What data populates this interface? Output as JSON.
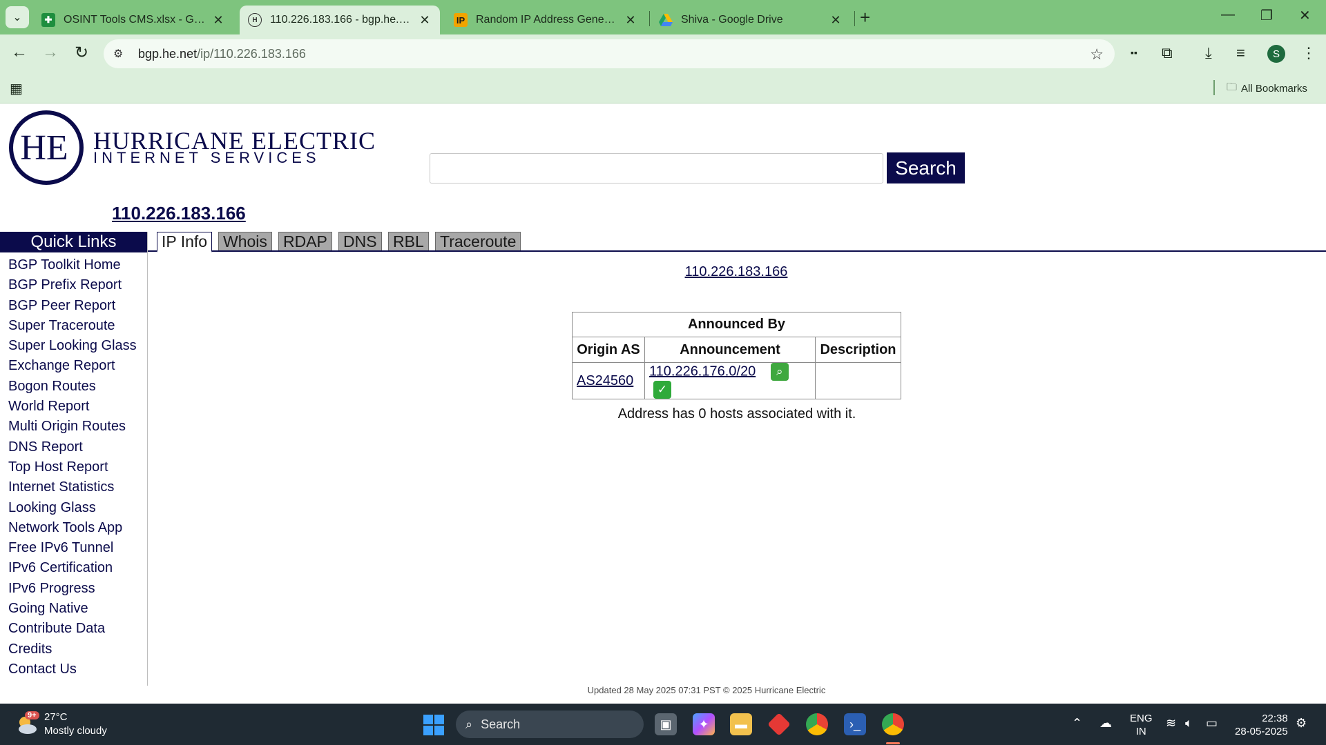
{
  "browser": {
    "tabs": [
      {
        "title": "OSINT Tools CMS.xlsx - Google",
        "favicon": "sheets-icon"
      },
      {
        "title": "110.226.183.166 - bgp.he.net",
        "favicon": "he-icon",
        "active": true
      },
      {
        "title": "Random IP Address Generator,",
        "favicon": "ip-icon",
        "favicon_text": "IP"
      },
      {
        "title": "Shiva - Google Drive",
        "favicon": "drive-icon"
      }
    ],
    "address_bar": {
      "host": "bgp.he.net",
      "path": "/ip/110.226.183.166"
    },
    "avatar_initial": "S",
    "all_bookmarks_label": "All Bookmarks"
  },
  "site": {
    "logo": {
      "initials": "HE",
      "line1": "HURRICANE ELECTRIC",
      "line2": "INTERNET SERVICES"
    },
    "search_button": "Search",
    "search_placeholder": "",
    "ip_heading": "110.226.183.166",
    "quick_links_title": "Quick Links",
    "quick_links": [
      "BGP Toolkit Home",
      "BGP Prefix Report",
      "BGP Peer Report",
      "Super Traceroute",
      "Super Looking Glass",
      "Exchange Report",
      "Bogon Routes",
      "World Report",
      "Multi Origin Routes",
      "DNS Report",
      "Top Host Report",
      "Internet Statistics",
      "Looking Glass",
      "Network Tools App",
      "Free IPv6 Tunnel",
      "IPv6 Certification",
      "IPv6 Progress",
      "Going Native",
      "Contribute Data",
      "Credits",
      "Contact Us"
    ],
    "tabs": [
      "IP Info",
      "Whois",
      "RDAP",
      "DNS",
      "RBL",
      "Traceroute"
    ],
    "result_ip": "110.226.183.166",
    "table": {
      "caption": "Announced By",
      "headers": [
        "Origin AS",
        "Announcement",
        "Description"
      ],
      "rows": [
        {
          "origin_as": "AS24560",
          "announcement": "110.226.176.0/20",
          "description": ""
        }
      ]
    },
    "hosts_note": "Address has 0 hosts associated with it.",
    "footer": "Updated 28 May 2025 07:31 PST © 2025 Hurricane Electric"
  },
  "taskbar": {
    "weather": {
      "temp": "27°C",
      "condition": "Mostly cloudy",
      "badge": "9+"
    },
    "search_label": "Search",
    "lang_line1": "ENG",
    "lang_line2": "IN",
    "time": "22:38",
    "date": "28-05-2025"
  },
  "colors": {
    "brand_navy": "#0b0b4b",
    "chrome_green": "#7ec47e",
    "chrome_light": "#dcefdc"
  }
}
